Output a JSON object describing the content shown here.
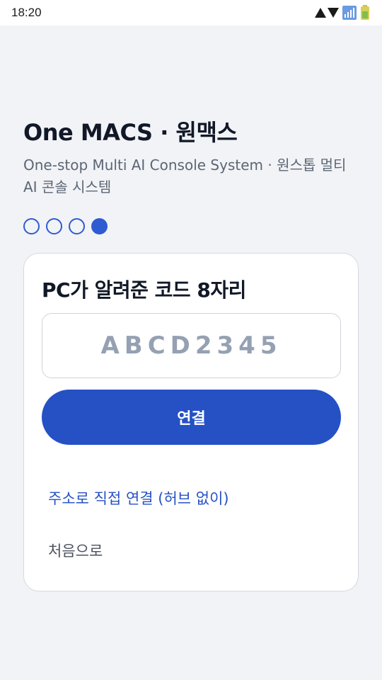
{
  "status_bar": {
    "time": "18:20",
    "icons": [
      "wifi-icon",
      "signal-icon",
      "battery-icon"
    ]
  },
  "header": {
    "title": "One MACS · 원맥스",
    "subtitle": "One-stop Multi AI Console System · 원스톱 멀티 AI 콘솔 시스템"
  },
  "steps": {
    "total": 4,
    "current": 4
  },
  "card": {
    "title": "PC가 알려준 코드 8자리",
    "code_input": {
      "value": "",
      "placeholder": "ABCD2345"
    },
    "connect_label": "연결",
    "direct_link_label": "주소로 직접 연결 (허브 없이)",
    "home_link_label": "처음으로"
  },
  "colors": {
    "accent": "#2551c5",
    "background": "#f1f3f6",
    "card": "#ffffff",
    "placeholder": "#95a1b3"
  }
}
